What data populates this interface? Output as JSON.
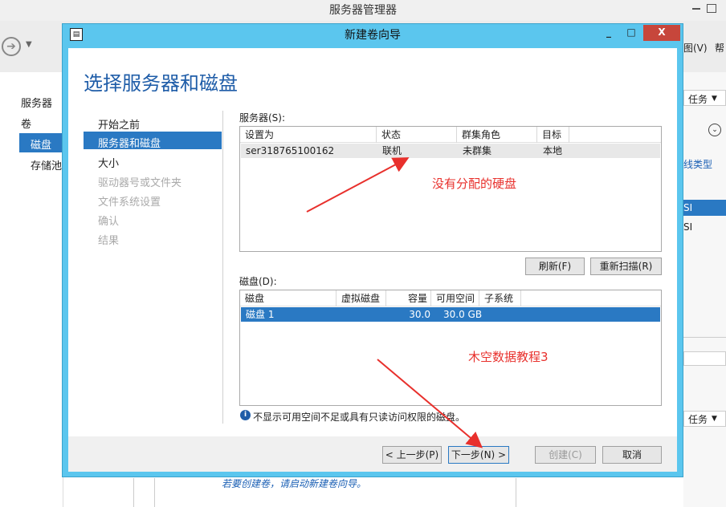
{
  "background_window": {
    "title": "服务器管理器",
    "back_glyph": "➔",
    "menu_view": "图(V)",
    "menu_help": "帮",
    "nav": [
      "服务器",
      "卷",
      "磁盘",
      "存储池"
    ],
    "tasks_top": "任务",
    "col_type": "线类型",
    "row_1": "SI",
    "row_2": "SI",
    "tasks_bottom": "任务",
    "hint_link": "若要创建卷，请启动新建卷向导。"
  },
  "dialog": {
    "title": "新建卷向导",
    "heading": "选择服务器和磁盘",
    "steps": [
      "开始之前",
      "服务器和磁盘",
      "大小",
      "驱动器号或文件夹",
      "文件系统设置",
      "确认",
      "结果"
    ],
    "servers": {
      "label": "服务器(S):",
      "columns": [
        "设置为",
        "状态",
        "群集角色",
        "目标"
      ],
      "rows": [
        [
          "ser318765100162",
          "联机",
          "未群集",
          "本地"
        ]
      ]
    },
    "refresh_button": "刷新(F)",
    "rescan_button": "重新扫描(R)",
    "disks": {
      "label": "磁盘(D):",
      "columns": [
        "磁盘",
        "虚拟磁盘",
        "容量",
        "可用空间",
        "子系统"
      ],
      "rows": [
        [
          "磁盘 1",
          "",
          "30.0 GB",
          "30.0 GB",
          ""
        ]
      ]
    },
    "info_text": "不显示可用空间不足或具有只读访问权限的磁盘。",
    "buttons": {
      "prev": "< 上一步(P)",
      "next": "下一步(N) >",
      "create": "创建(C)",
      "cancel": "取消"
    }
  },
  "annotations": {
    "note_1": "没有分配的硬盘",
    "note_2": "木空数据教程3",
    "color": "#e8302c"
  },
  "colors": {
    "accent": "#2a79c3",
    "title_bar": "#5bc6ee",
    "heading": "#1f5da8"
  }
}
